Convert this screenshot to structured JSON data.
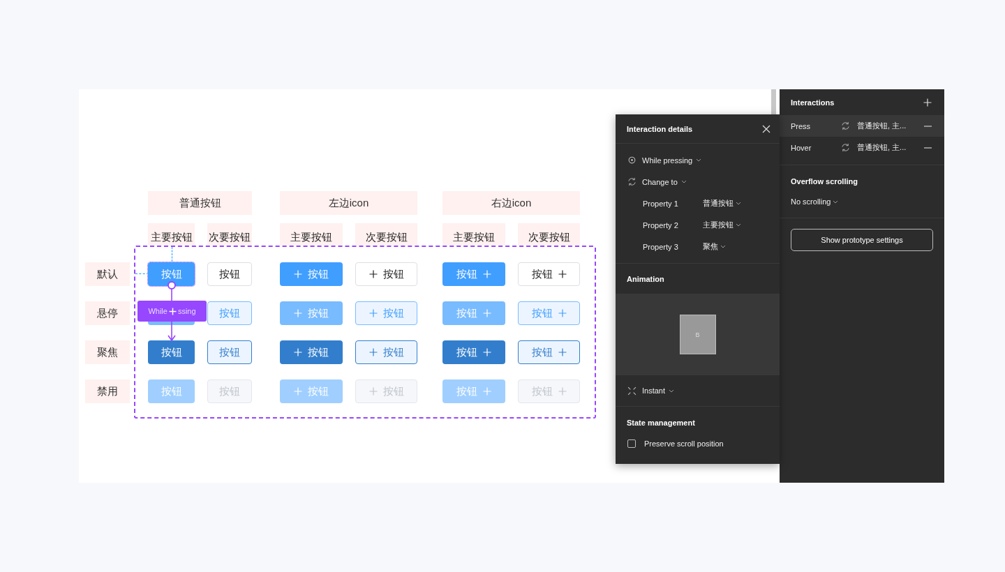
{
  "canvas": {
    "group_headers": [
      "普通按钮",
      "左边icon",
      "右边icon"
    ],
    "sub_headers": [
      "主要按钮",
      "次要按钮",
      "主要按钮",
      "次要按钮",
      "主要按钮",
      "次要按钮"
    ],
    "rows": [
      {
        "label": "默认",
        "kind": "default",
        "buttons": [
          {
            "kind": "primary",
            "label": "按钮",
            "selected": true
          },
          {
            "kind": "secondary",
            "label": "按钮",
            "selected": false
          },
          {
            "kind": "primary",
            "label": "按钮",
            "selected": false
          },
          {
            "kind": "secondary",
            "label": "按钮",
            "selected": false
          },
          {
            "kind": "primary",
            "label": "按钮",
            "selected": false
          },
          {
            "kind": "secondary",
            "label": "按钮",
            "selected": false
          }
        ]
      },
      {
        "label": "悬停",
        "kind": "hover",
        "buttons": [
          {
            "kind": "primary",
            "selected": false
          },
          {
            "kind": "secondary",
            "label": "按钮",
            "selected": false
          },
          {
            "kind": "primary",
            "label": "按钮",
            "selected": false
          },
          {
            "kind": "secondary",
            "label": "按钮",
            "selected": false
          },
          {
            "kind": "primary",
            "label": "按钮",
            "selected": false
          },
          {
            "kind": "secondary",
            "label": "按钮",
            "selected": false
          }
        ]
      },
      {
        "label": "聚焦",
        "kind": "focus",
        "buttons": [
          {
            "kind": "primary",
            "label": "按钮",
            "selected": false
          },
          {
            "kind": "secondary",
            "label": "按钮",
            "selected": false
          },
          {
            "kind": "primary",
            "label": "按钮",
            "selected": false
          },
          {
            "kind": "secondary",
            "label": "按钮",
            "selected": false
          },
          {
            "kind": "primary",
            "label": "按钮",
            "selected": false
          },
          {
            "kind": "secondary",
            "label": "按钮",
            "selected": false
          }
        ]
      },
      {
        "label": "禁用",
        "kind": "disabled",
        "buttons": [
          {
            "kind": "primary",
            "label": "按钮",
            "selected": false
          },
          {
            "kind": "secondary",
            "label": "按钮",
            "selected": false
          },
          {
            "kind": "primary",
            "label": "按钮",
            "selected": false
          },
          {
            "kind": "secondary",
            "label": "按钮",
            "selected": false
          },
          {
            "kind": "primary",
            "label": "按钮",
            "selected": false
          },
          {
            "kind": "secondary",
            "label": "按钮",
            "selected": false
          }
        ]
      }
    ],
    "connector": {
      "label_start": "While",
      "label_end": "ssing"
    }
  },
  "interaction_details": {
    "title": "Interaction details",
    "trigger": "While pressing",
    "action": "Change to",
    "properties": [
      {
        "name": "Property 1",
        "value": "普通按钮"
      },
      {
        "name": "Property 2",
        "value": "主要按钮"
      },
      {
        "name": "Property 3",
        "value": "聚焦"
      }
    ],
    "animation_title": "Animation",
    "preview_letter": "B",
    "transition": "Instant",
    "state_title": "State management",
    "preserve_scroll": {
      "label": "Preserve scroll position",
      "checked": false
    }
  },
  "sidebar": {
    "title": "Interactions",
    "interactions": [
      {
        "trigger": "Press",
        "summary": "普通按钮, 主...",
        "selected": true
      },
      {
        "trigger": "Hover",
        "summary": "普通按钮, 主...",
        "selected": false
      }
    ],
    "overflow_title": "Overflow scrolling",
    "overflow_value": "No scrolling",
    "settings_button": "Show prototype settings"
  }
}
